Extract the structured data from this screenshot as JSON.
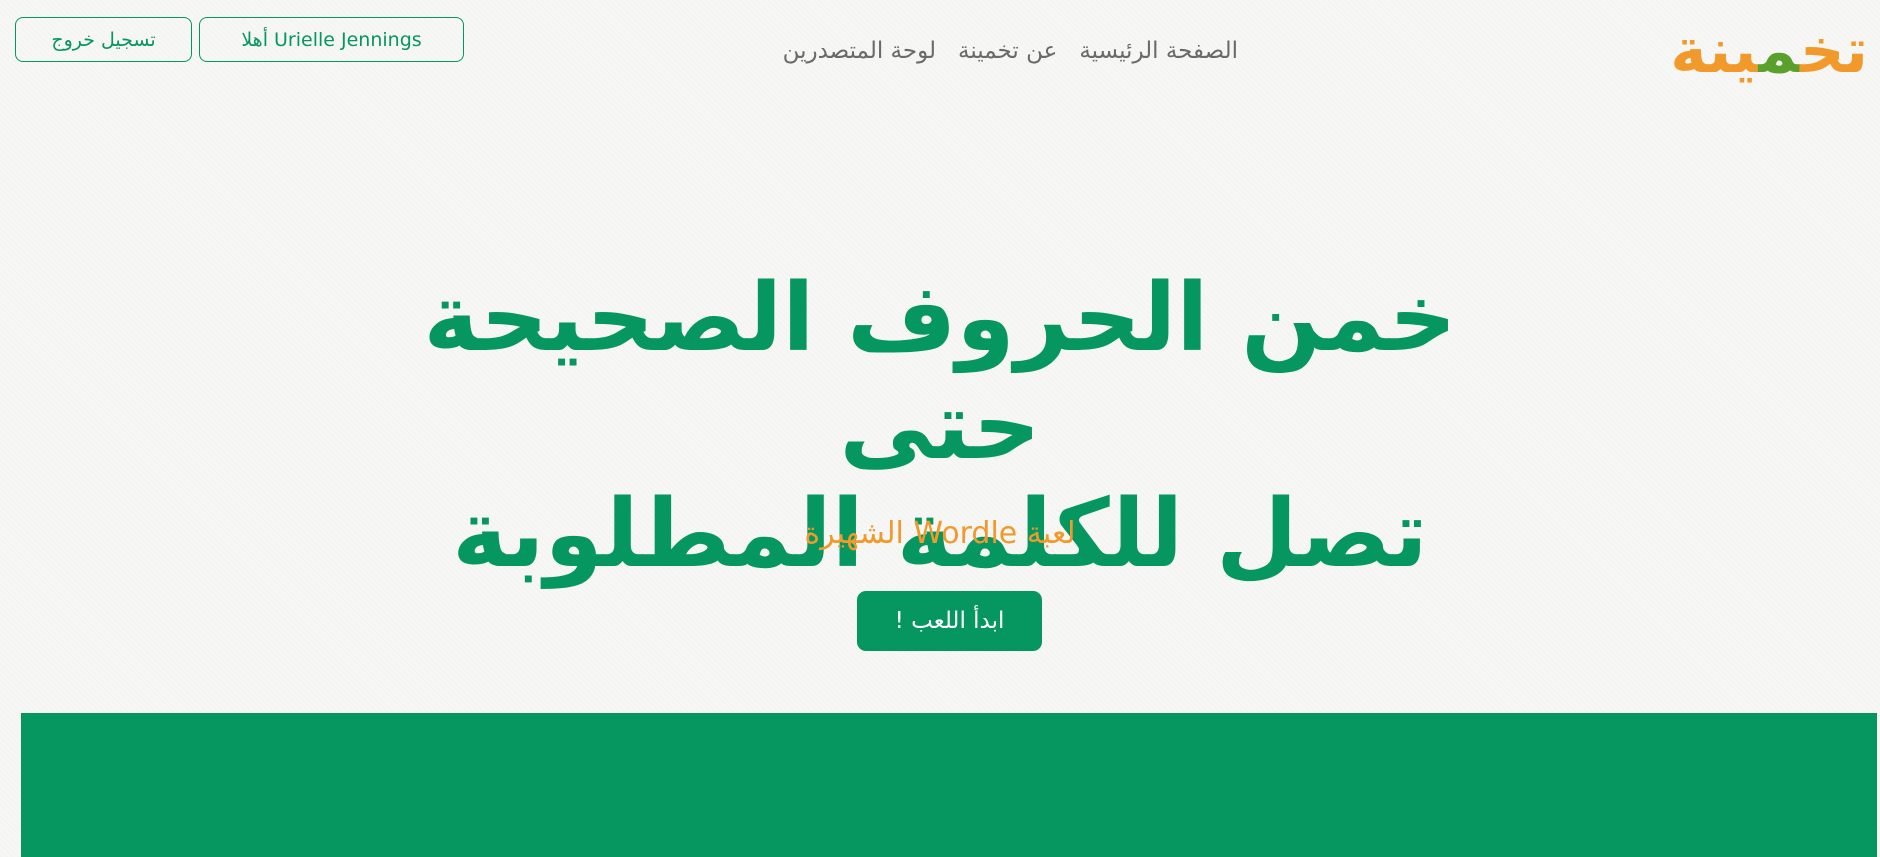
{
  "header": {
    "logo": {
      "parts": [
        {
          "text": "تخ",
          "color": "#f19a2b"
        },
        {
          "text": "م",
          "color": "#5aa02c"
        },
        {
          "text": "ينة",
          "color": "#f19a2b"
        }
      ]
    },
    "nav": {
      "home": "الصفحة الرئيسية",
      "about": "عن تخمينة",
      "leaderboard": "لوحة المتصدرين"
    },
    "greeting_label": "أهلا Urielle Jennings",
    "logout_label": "تسجيل خروج"
  },
  "hero": {
    "title_line1": "خمن الحروف الصحيحة حتى",
    "title_line2": "تصل للكلمة المطلوبة",
    "subtitle": "لعبة Wordle الشهيرة",
    "play_button": "ابدأ اللعب !"
  },
  "colors": {
    "brand_green": "#069660",
    "brand_orange": "#f19a2b",
    "logo_green": "#5aa02c",
    "nav_gray": "#6a6a6a",
    "background": "#f7f7f5"
  }
}
